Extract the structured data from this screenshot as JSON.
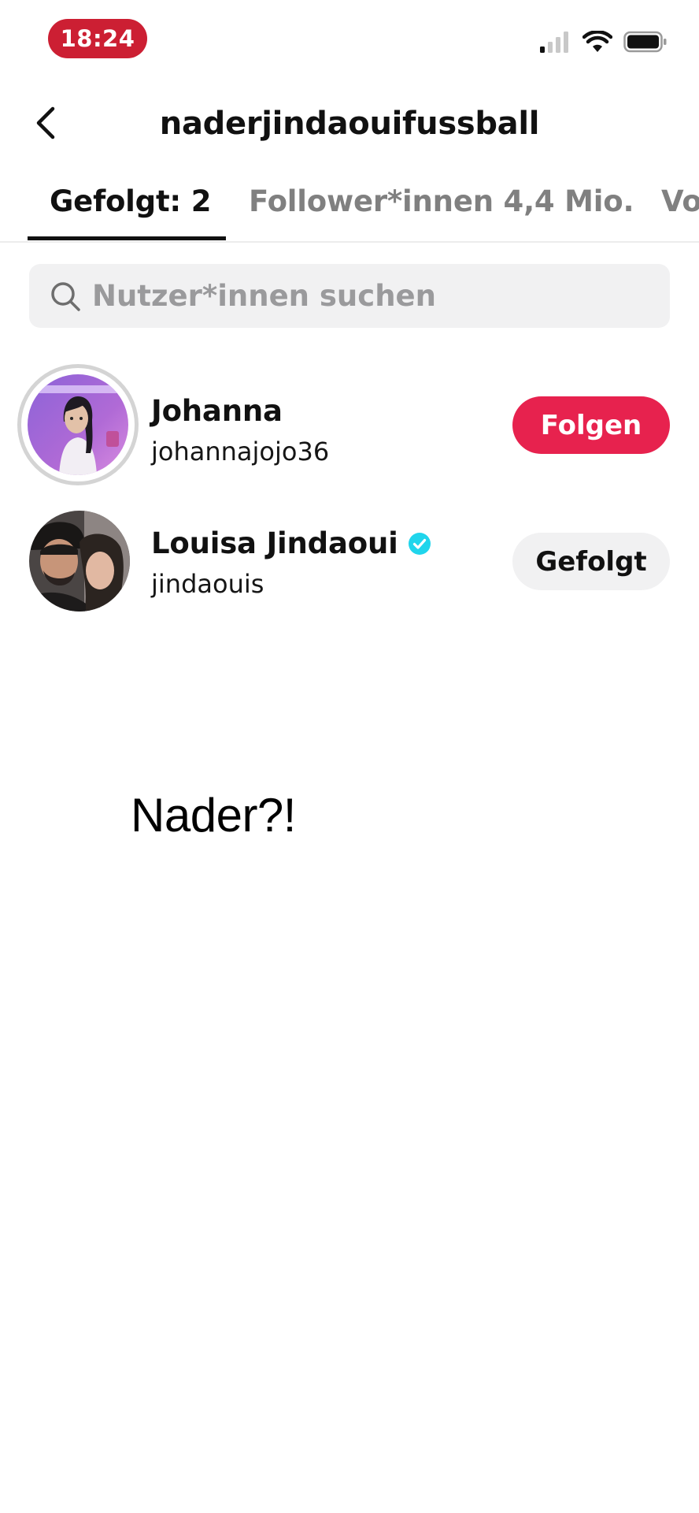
{
  "status_bar": {
    "time": "18:24",
    "time_pill_color": "#cc1f33",
    "icons": [
      "cellular-signal-icon",
      "wifi-icon",
      "battery-icon"
    ]
  },
  "header": {
    "back_icon": "chevron-left-icon",
    "title": "naderjindaouifussball"
  },
  "tabs": [
    {
      "label": "Gefolgt: 2",
      "active": true
    },
    {
      "label": "Follower*innen 4,4 Mio.",
      "active": false
    },
    {
      "label": "Vo",
      "active": false
    }
  ],
  "search": {
    "placeholder": "Nutzer*innen suchen",
    "icon": "search-icon"
  },
  "users": [
    {
      "name": "Johanna",
      "handle": "johannajojo36",
      "verified": false,
      "has_story_ring": true,
      "button_label": "Folgen",
      "button_color": "#e7224e"
    },
    {
      "name": "Louisa Jindaoui",
      "handle": "jindaouis",
      "verified": true,
      "verified_color": "#20d5ec",
      "has_story_ring": false,
      "button_label": "Gefolgt",
      "button_color": "#f1f1f2"
    }
  ],
  "overlay_caption": "Nader?!"
}
